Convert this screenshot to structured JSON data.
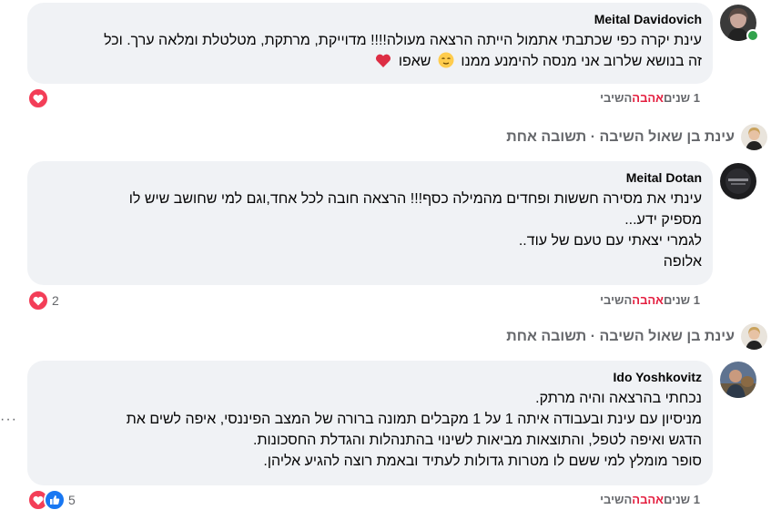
{
  "comments": [
    {
      "author": "Meital Davidovich",
      "lines": [
        "עינת יקרה כפי שכתבתי אתמול הייתה הרצאה מעולה!!!! מדוייקת, מרתקת, מטלטלת ומלאה ערך. וכל",
        "זה בנושא שלרוב אני מנסה להימנע ממנו"
      ],
      "suffix": "שאפו",
      "time": "1 שנים",
      "like": "אהבה",
      "reply": "השיבי",
      "reaction_count": ""
    },
    {
      "author": "Meital Dotan",
      "lines": [
        "עינתי את מסירה חששות ופחדים מהמילה כסף!!! הרצאה חובה לכל אחד,וגם למי שחושב שיש לו",
        "מספיק ידע...",
        "לגמרי יצאתי עם טעם של עוד..",
        "אלופה"
      ],
      "time": "1 שנים",
      "like": "אהבה",
      "reply": "השיבי",
      "reaction_count": "2"
    },
    {
      "author": "Ido Yoshkovitz",
      "lines": [
        "נכחתי בהרצאה והיה מרתק.",
        "מניסיון עם עינת ובעבודה איתה 1 על 1 מקבלים תמונה ברורה של המצב הפיננסי, איפה לשים את",
        "הדגש ואיפה לטפל, והתוצאות מביאות לשינוי בהתנהלות והגדלת החסכונות.",
        "סופר מומלץ למי ששם לו מטרות גדולות לעתיד ובאמת רוצה להגיע אליהן."
      ],
      "time": "1 שנים",
      "like": "אהבה",
      "reply": "השיבי",
      "reaction_count": "5"
    }
  ],
  "replies_link": "עינת בן שאול השיבה · תשובה אחת",
  "more_dots": "···",
  "colors": {
    "bubble": "#f0f2f5",
    "love": "#e41e3f",
    "like": "#1877f2",
    "meta": "#65676b"
  }
}
